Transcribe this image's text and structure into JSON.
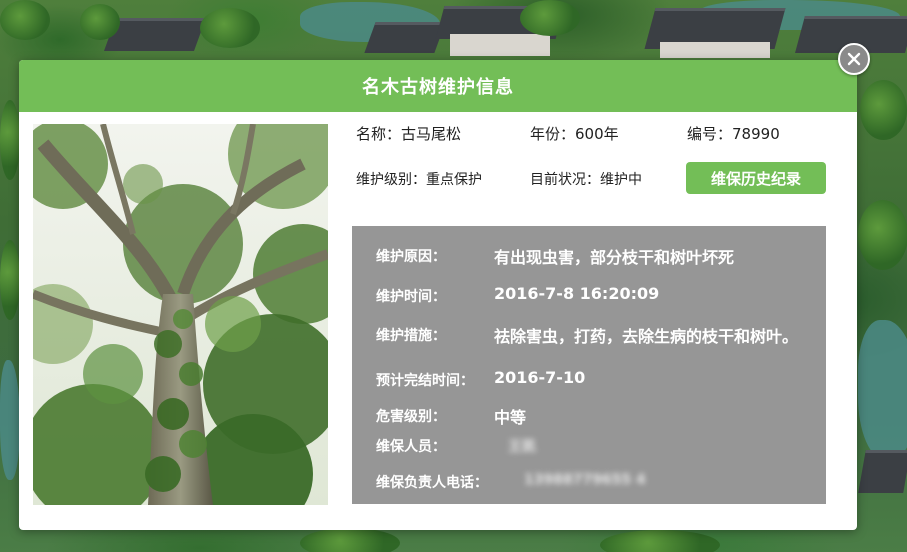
{
  "modal": {
    "title": "名木古树维护信息",
    "close_icon": "close-icon"
  },
  "tree": {
    "name_label": "名称：",
    "name_value": "古马尾松",
    "age_label": "年份：",
    "age_value": "600年",
    "id_label": "编号：",
    "id_value": "78990",
    "level_label": "维护级别：",
    "level_value": "重点保护",
    "status_label": "目前状况：",
    "status_value": "维护中",
    "history_button": "维保历史纪录"
  },
  "record": {
    "reason_label": "维护原因：",
    "reason_value": "有出现虫害，部分枝干和树叶坏死",
    "time_label": "维护时间：",
    "time_value": "2016-7-8  16:20:09",
    "measure_label": "维护措施：",
    "measure_value": "祛除害虫，打药，去除生病的枝干和树叶。",
    "eta_label": "预计完结时间：",
    "eta_value": "2016-7-10",
    "hazard_label": "危害级别：",
    "hazard_value": "中等",
    "staff_label": "维保人员：",
    "staff_value": "王凯",
    "phone_label": "维保负责人电话：",
    "phone_value": "13988779655 4"
  },
  "colors": {
    "header_green": "#73be57",
    "panel_gray": "#969696",
    "button_green": "#73be57"
  }
}
